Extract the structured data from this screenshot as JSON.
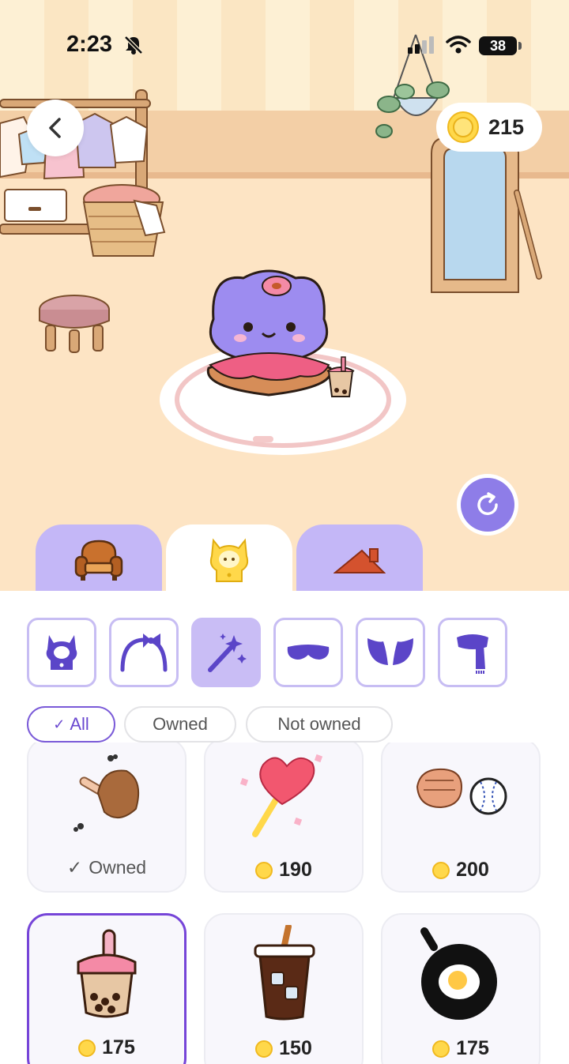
{
  "status_bar": {
    "time": "2:23",
    "battery": "38"
  },
  "header": {
    "coins": "215"
  },
  "category_tabs": [
    {
      "icon": "armchair-icon",
      "active": false
    },
    {
      "icon": "cat-outfit-icon",
      "active": true
    },
    {
      "icon": "roof-icon",
      "active": false
    }
  ],
  "sub_tabs": [
    {
      "icon": "costume-icon",
      "active": false
    },
    {
      "icon": "headband-icon",
      "active": false
    },
    {
      "icon": "magic-wand-icon",
      "active": true
    },
    {
      "icon": "eye-mask-icon",
      "active": false
    },
    {
      "icon": "wings-icon",
      "active": false
    },
    {
      "icon": "scarf-icon",
      "active": false
    }
  ],
  "filters": {
    "all": "All",
    "owned": "Owned",
    "not_owned": "Not owned",
    "check": "✓"
  },
  "items": [
    {
      "name": "roast-drumstick",
      "owned_label": "Owned",
      "price": null
    },
    {
      "name": "heart-lollipop",
      "price": "190"
    },
    {
      "name": "baseball-glove",
      "price": "200"
    },
    {
      "name": "bubble-tea",
      "price": "175",
      "selected": true
    },
    {
      "name": "iced-coffee",
      "price": "150"
    },
    {
      "name": "fried-egg-pan",
      "price": "175"
    }
  ],
  "colors": {
    "accent": "#7645d8",
    "tab_purple": "#c4b7f7",
    "coin": "#ffd84a"
  }
}
